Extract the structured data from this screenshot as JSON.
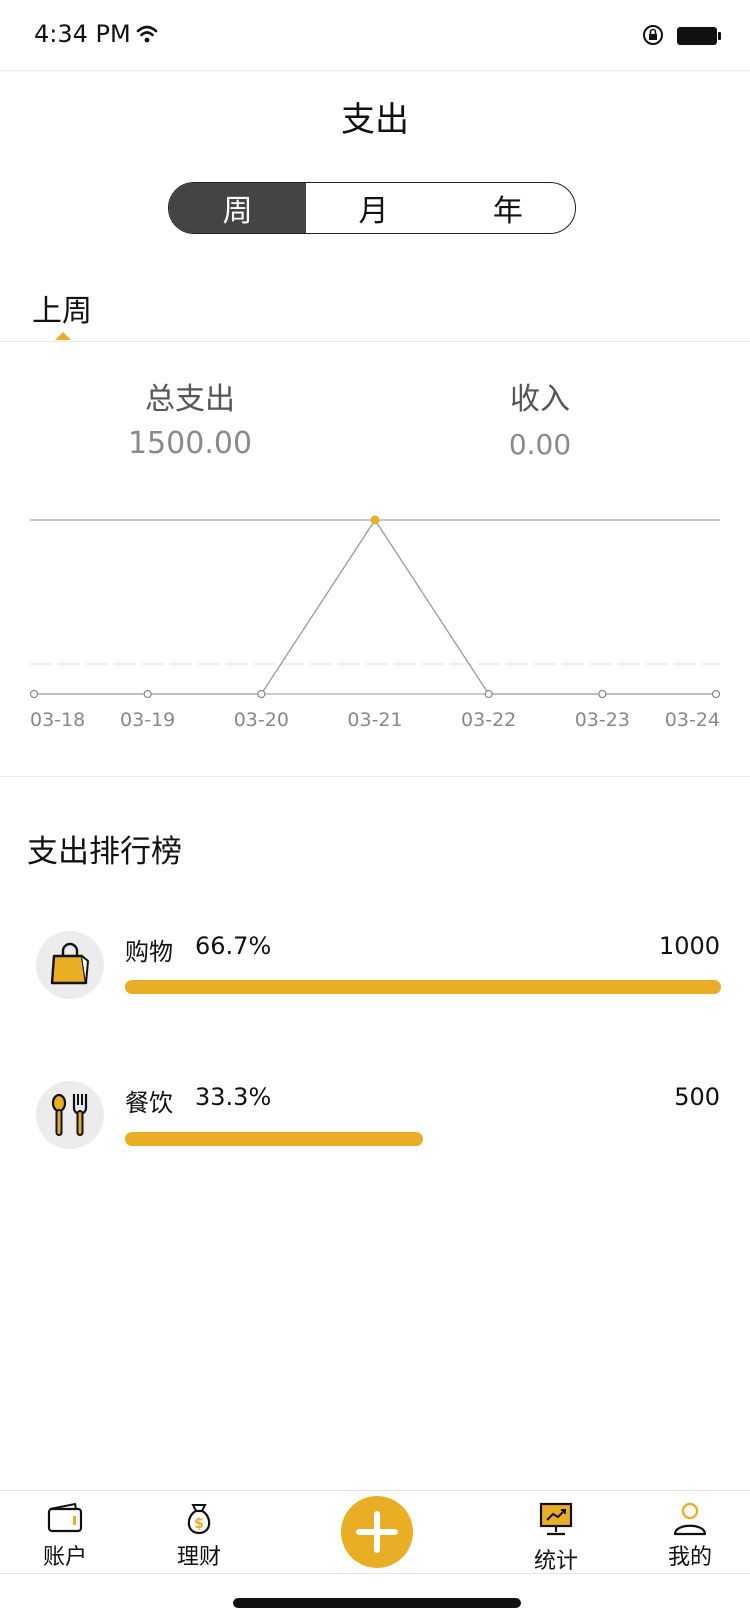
{
  "status_bar": {
    "time": "4:34 PM"
  },
  "header": {
    "title": "支出"
  },
  "segmented": {
    "week": "周",
    "month": "月",
    "year": "年",
    "selected": "周"
  },
  "period": {
    "label": "上周"
  },
  "summary": {
    "expense_label": "总支出",
    "expense_value": "1500.00",
    "income_label": "收入",
    "income_value": "0.00"
  },
  "chart_data": {
    "type": "line",
    "x": [
      "03-18",
      "03-19",
      "03-20",
      "03-21",
      "03-22",
      "03-23",
      "03-24"
    ],
    "series": [
      {
        "values": [
          0,
          0,
          0,
          1500,
          0,
          0,
          0
        ]
      }
    ],
    "ylim": [
      0,
      1500
    ],
    "highlight_index": 3,
    "grid": true
  },
  "ranking": {
    "title": "支出排行榜",
    "items": [
      {
        "name": "购物",
        "percent": "66.7%",
        "amount": "1000",
        "fraction": 1.0,
        "icon": "shopping-bag-icon"
      },
      {
        "name": "餐饮",
        "percent": "33.3%",
        "amount": "500",
        "fraction": 0.5,
        "icon": "spoon-fork-icon"
      }
    ]
  },
  "tabbar": {
    "items": [
      {
        "label": "账户",
        "icon": "wallet-icon"
      },
      {
        "label": "理财",
        "icon": "money-bag-icon"
      },
      {
        "label": "统计",
        "icon": "chart-board-icon"
      },
      {
        "label": "我的",
        "icon": "user-icon"
      }
    ],
    "add_icon": "plus-icon"
  },
  "colors": {
    "accent": "#e9ad26",
    "segment_active": "#444444"
  }
}
